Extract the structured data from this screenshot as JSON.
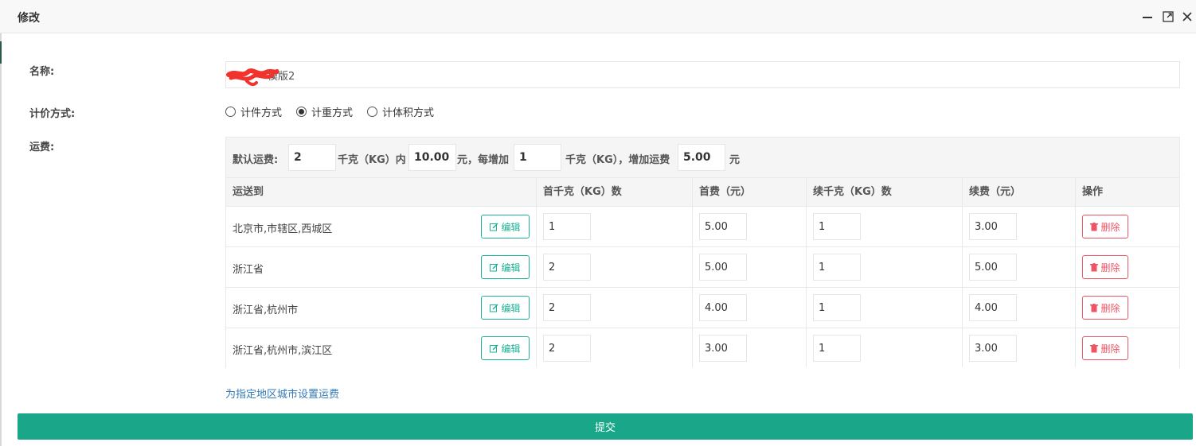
{
  "dialog": {
    "title": "修改"
  },
  "form": {
    "name_label": "名称:",
    "name_value": "模版2",
    "pricing_label": "计价方式:",
    "pricing_options": [
      "计件方式",
      "计重方式",
      "计体积方式"
    ],
    "pricing_selected": "计重方式",
    "fee_label": "运费:"
  },
  "default_fee": {
    "prefix": "默认运费:",
    "first_weight": "2",
    "unit_within": "千克（KG）内",
    "first_fee": "10.00",
    "each_add_text": "元，每增加",
    "add_weight": "1",
    "unit_add": "千克（KG），增加运费",
    "add_fee": "5.00",
    "suffix": "元"
  },
  "table": {
    "headers": [
      "运送到",
      "首千克（KG）数",
      "首费（元）",
      "续千克（KG）数",
      "续费（元）",
      "操作"
    ],
    "edit_label": "编辑",
    "delete_label": "删除",
    "rows": [
      {
        "region": "北京市,市辖区,西城区",
        "first_weight": "1",
        "first_fee": "5.00",
        "add_weight": "1",
        "add_fee": "3.00"
      },
      {
        "region": "浙江省",
        "first_weight": "2",
        "first_fee": "5.00",
        "add_weight": "1",
        "add_fee": "5.00"
      },
      {
        "region": "浙江省,杭州市",
        "first_weight": "2",
        "first_fee": "4.00",
        "add_weight": "1",
        "add_fee": "4.00"
      },
      {
        "region": "浙江省,杭州市,滨江区",
        "first_weight": "2",
        "first_fee": "3.00",
        "add_weight": "1",
        "add_fee": "3.00"
      }
    ]
  },
  "add_region_link": "为指定地区城市设置运费",
  "submit_label": "提交",
  "colors": {
    "primary": "#1aa789",
    "edit": "#1ab394",
    "danger": "#ed5565",
    "link": "#337ab7"
  }
}
